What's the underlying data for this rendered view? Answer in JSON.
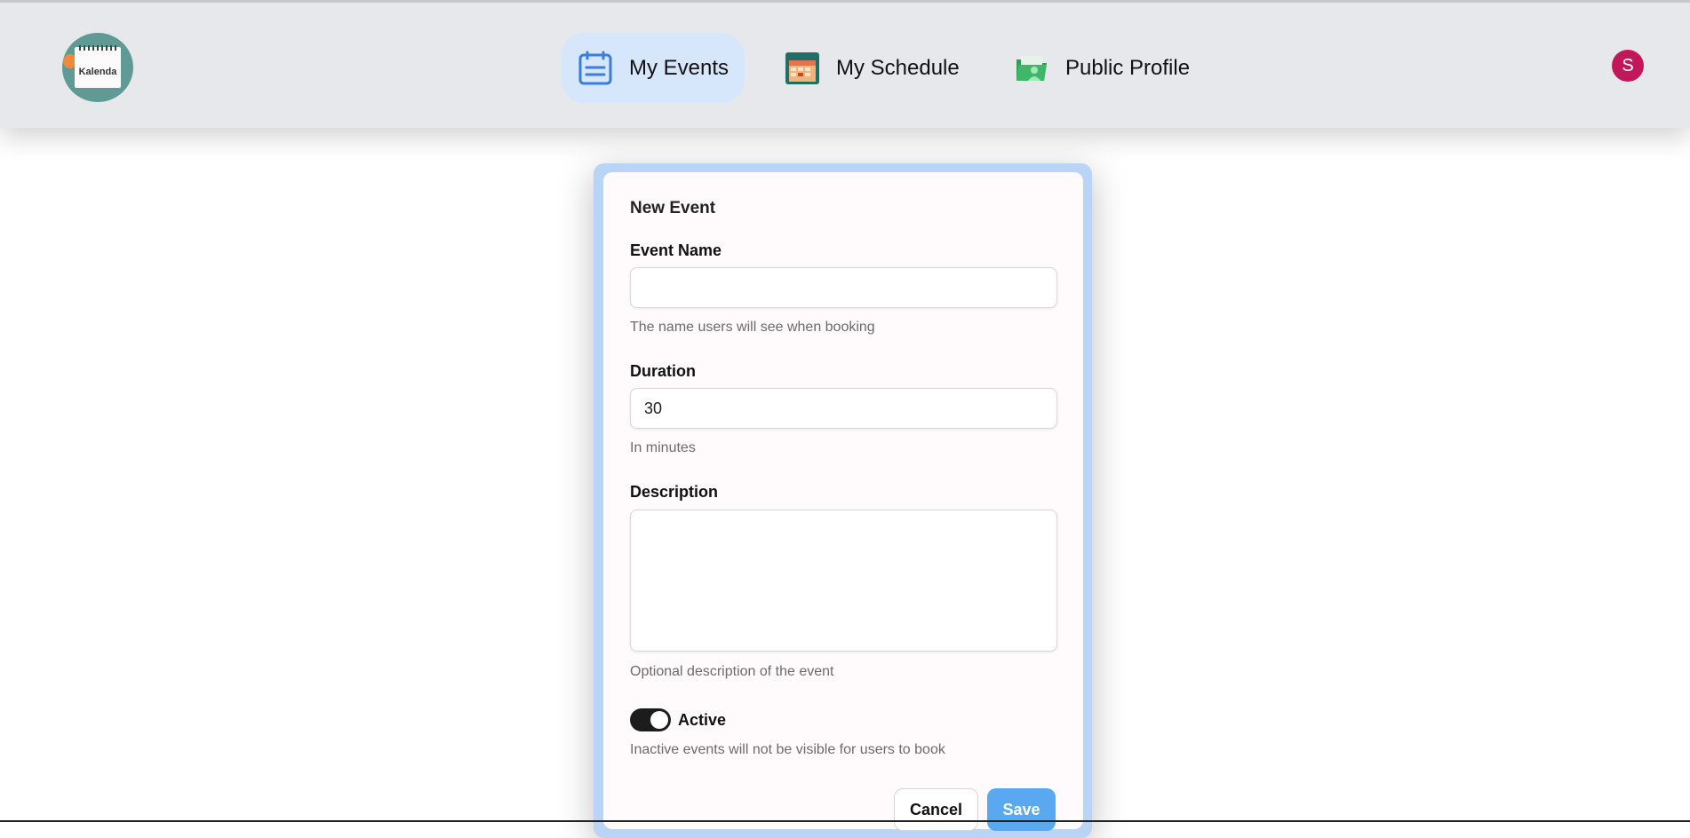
{
  "app": {
    "logo_text": "Kalenda"
  },
  "nav": {
    "items": [
      {
        "label": "My Events",
        "icon": "clipboard-list-icon",
        "active": true
      },
      {
        "label": "My Schedule",
        "icon": "calendar-grid-icon",
        "active": false
      },
      {
        "label": "Public Profile",
        "icon": "folder-person-icon",
        "active": false
      }
    ]
  },
  "user": {
    "avatar_initial": "S",
    "avatar_color": "#c2185b"
  },
  "form": {
    "title": "New Event",
    "event_name": {
      "label": "Event Name",
      "value": "",
      "hint": "The name users will see when booking"
    },
    "duration": {
      "label": "Duration",
      "value": "30",
      "hint": "In minutes"
    },
    "description": {
      "label": "Description",
      "value": "",
      "hint": "Optional description of the event"
    },
    "active": {
      "label": "Active",
      "checked": true,
      "hint": "Inactive events will not be visible for users to book"
    },
    "cancel_label": "Cancel",
    "save_label": "Save"
  },
  "colors": {
    "active_nav_bg": "#d6e6fb",
    "save_button": "#5aa8f0",
    "modal_frame": "#b9d4f4"
  }
}
